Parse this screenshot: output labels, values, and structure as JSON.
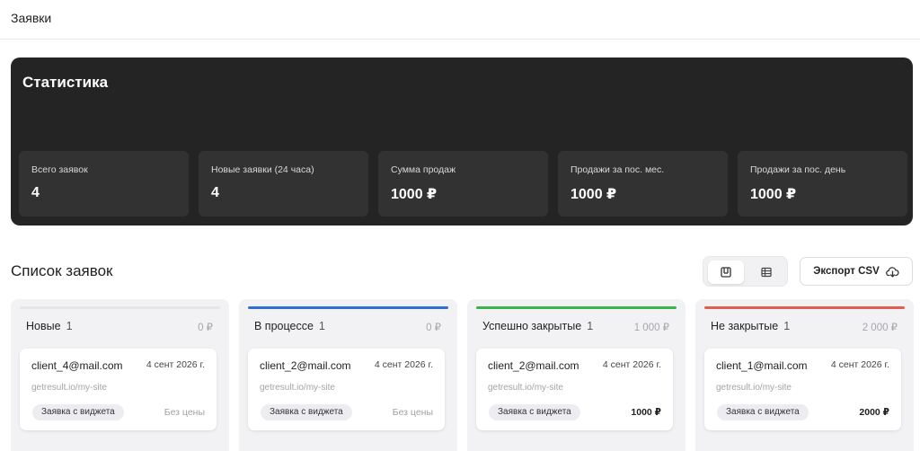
{
  "header": {
    "title": "Заявки"
  },
  "stats": {
    "heading": "Статистика",
    "cards": [
      {
        "label": "Всего заявок",
        "value": "4"
      },
      {
        "label": "Новые заявки (24 часа)",
        "value": "4"
      },
      {
        "label": "Сумма продаж",
        "value": "1000 ₽"
      },
      {
        "label": "Продажи за пос. мес.",
        "value": "1000 ₽"
      },
      {
        "label": "Продажи за пос. день",
        "value": "1000 ₽"
      }
    ]
  },
  "list": {
    "title": "Список заявок",
    "view_toggle": {
      "kanban_icon": "kanban-icon",
      "table_icon": "table-icon",
      "active": "kanban"
    },
    "export_label": "Экспорт CSV",
    "export_icon": "cloud-download-icon"
  },
  "columns": [
    {
      "name": "Новые",
      "count": "1",
      "sum": "0 ₽",
      "color": "#e6e6ea",
      "card": {
        "email": "client_4@mail.com",
        "date": "4 сент 2026 г.",
        "site": "getresult.io/my-site",
        "tag": "Заявка с виджета",
        "price": "Без цены"
      }
    },
    {
      "name": "В процессе",
      "count": "1",
      "sum": "0 ₽",
      "color": "#2f6fd1",
      "card": {
        "email": "client_2@mail.com",
        "date": "4 сент 2026 г.",
        "site": "getresult.io/my-site",
        "tag": "Заявка с виджета",
        "price": "Без цены"
      }
    },
    {
      "name": "Успешно закрытые",
      "count": "1",
      "sum": "1 000 ₽",
      "color": "#3bb24a",
      "card": {
        "email": "client_2@mail.com",
        "date": "4 сент 2026 г.",
        "site": "getresult.io/my-site",
        "tag": "Заявка с виджета",
        "price": "1000 ₽"
      }
    },
    {
      "name": "Не закрытые",
      "count": "1",
      "sum": "2 000 ₽",
      "color": "#e0604f",
      "card": {
        "email": "client_1@mail.com",
        "date": "4 сент 2026 г.",
        "site": "getresult.io/my-site",
        "tag": "Заявка с виджета",
        "price": "2000 ₽"
      }
    }
  ]
}
